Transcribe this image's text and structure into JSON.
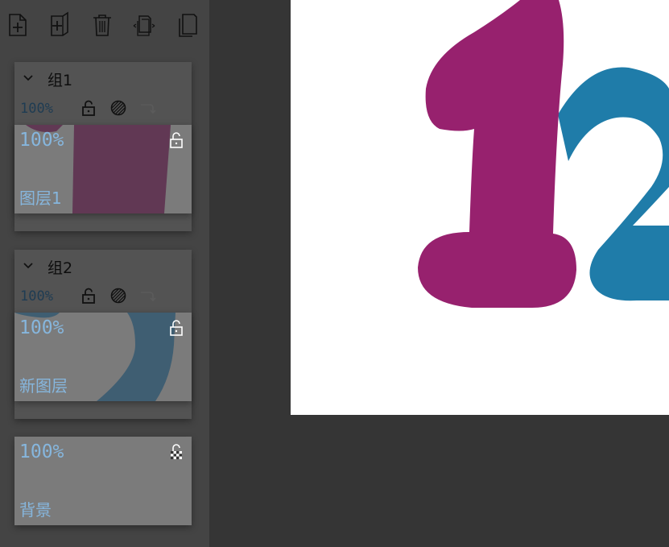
{
  "toolbar": {
    "buttons": [
      {
        "icon": "new-layer-icon"
      },
      {
        "icon": "new-group-icon"
      },
      {
        "icon": "delete-icon"
      },
      {
        "icon": "merge-icon"
      },
      {
        "icon": "duplicate-icon"
      }
    ]
  },
  "groups": [
    {
      "name": "组1",
      "opacity": "100%",
      "layer": {
        "opacity": "100%",
        "name": "图层1"
      }
    },
    {
      "name": "组2",
      "opacity": "100%",
      "layer": {
        "opacity": "100%",
        "name": "新图层"
      }
    }
  ],
  "background_layer": {
    "opacity": "100%",
    "name": "背景"
  },
  "colors": {
    "digit_one": "#97216e",
    "digit_two": "#1f7ca9",
    "label_blue": "#86b6dd",
    "panel_bg": "#444444",
    "workspace_bg": "#353535"
  }
}
